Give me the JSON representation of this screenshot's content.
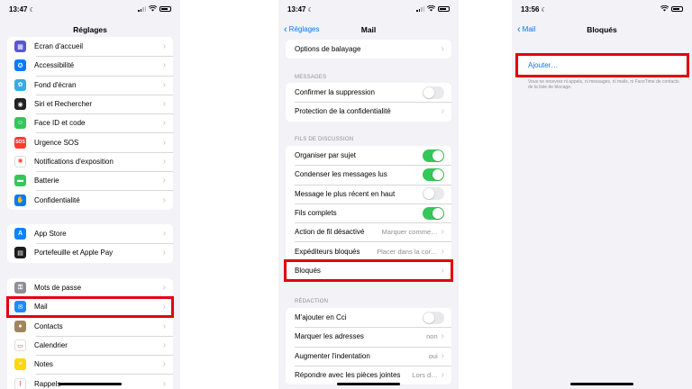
{
  "left_screen": {
    "status": {
      "time": "13:47",
      "moon": "☾"
    },
    "title": "Réglages",
    "group1": [
      {
        "label": "Écran d'accueil",
        "icon": "home-screen-icon",
        "color": "#5856d6"
      },
      {
        "label": "Accessibilité",
        "icon": "accessibility-icon",
        "color": "#007aff"
      },
      {
        "label": "Fond d'écran",
        "icon": "wallpaper-icon",
        "color": "#32ade6"
      },
      {
        "label": "Siri et Rechercher",
        "icon": "siri-icon",
        "color": "#222222"
      },
      {
        "label": "Face ID et code",
        "icon": "face-id-icon",
        "color": "#34c759"
      },
      {
        "label": "Urgence SOS",
        "icon": "sos-icon",
        "color": "#ff3b30"
      },
      {
        "label": "Notifications d'exposition",
        "icon": "exposure-icon",
        "color": "#ffffff"
      },
      {
        "label": "Batterie",
        "icon": "battery-icon",
        "color": "#34c759"
      },
      {
        "label": "Confidentialité",
        "icon": "privacy-hand-icon",
        "color": "#007aff"
      }
    ],
    "group2": [
      {
        "label": "App Store",
        "icon": "app-store-icon",
        "color": "#0a84ff"
      },
      {
        "label": "Portefeuille et Apple Pay",
        "icon": "wallet-icon",
        "color": "#1c1c1e"
      }
    ],
    "group3": [
      {
        "label": "Mots de passe",
        "icon": "key-icon",
        "color": "#8e8e93"
      },
      {
        "label": "Mail",
        "icon": "mail-icon",
        "color": "#1a8cff"
      },
      {
        "label": "Contacts",
        "icon": "contacts-icon",
        "color": "#a2845e"
      },
      {
        "label": "Calendrier",
        "icon": "calendar-icon",
        "color": "#ffffff"
      },
      {
        "label": "Notes",
        "icon": "notes-icon",
        "color": "#ffd60a"
      },
      {
        "label": "Rappels",
        "icon": "reminders-icon",
        "color": "#ffffff"
      }
    ],
    "sos_text": "SOS"
  },
  "middle_screen": {
    "status": {
      "time": "13:47",
      "moon": "☾"
    },
    "back_label": "Réglages",
    "title": "Mail",
    "top_row": "Options de balayage",
    "messages_header": "MESSAGES",
    "messages_rows": [
      {
        "label": "Confirmer la suppression",
        "toggle": false
      },
      {
        "label": "Protection de la confidentialité"
      }
    ],
    "threads_header": "FILS DE DISCUSSION",
    "threads_rows": [
      {
        "label": "Organiser par sujet",
        "toggle": true
      },
      {
        "label": "Condenser les messages lus",
        "toggle": true
      },
      {
        "label": "Message le plus récent en haut",
        "toggle": false
      },
      {
        "label": "Fils complets",
        "toggle": true
      },
      {
        "label": "Action de fil désactivé",
        "value": "Marquer comme…"
      },
      {
        "label": "Expéditeurs bloqués",
        "value": "Placer dans la cor…"
      },
      {
        "label": "Bloqués"
      }
    ],
    "compose_header": "RÉDACTION",
    "compose_rows": [
      {
        "label": "M'ajouter en Cci",
        "toggle": false
      },
      {
        "label": "Marquer les adresses",
        "value": "non"
      },
      {
        "label": "Augmenter l'indentation",
        "value": "oui"
      },
      {
        "label": "Répondre avec les pièces jointes",
        "value": "Lors d…"
      }
    ]
  },
  "right_screen": {
    "status": {
      "time": "13:56",
      "moon": "☾"
    },
    "back_label": "Mail",
    "title": "Bloqués",
    "add_label": "Ajouter…",
    "note": "Vous ne recevrez ni appels, ni messages, ni mails, ni FaceTime de contacts de la liste de blocage."
  },
  "highlight_color": "#e4000f"
}
